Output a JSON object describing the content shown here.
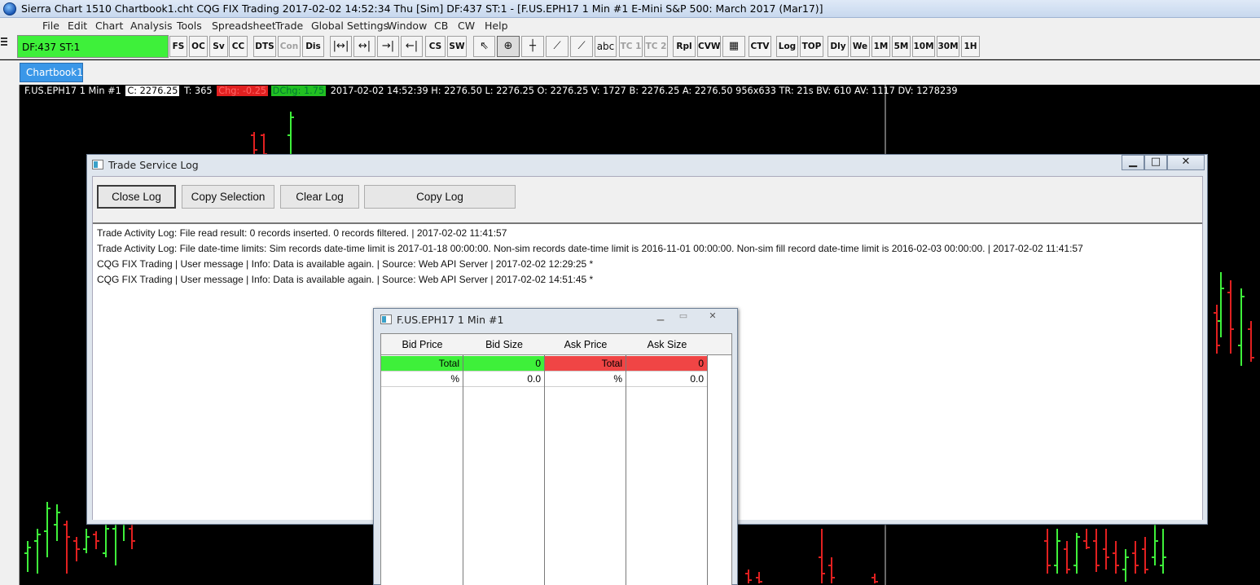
{
  "titlebar": {
    "title": "Sierra Chart 1510 Chartbook1.cht  CQG FIX Trading 2017-02-02  14:52:34 Thu [Sim]  DF:437  ST:1 - [F.US.EPH17  1 Min  #1  E-Mini S&P 500: March 2017 (Mar17)]"
  },
  "menu": [
    "File",
    "Edit",
    "Chart",
    "Analysis",
    "Tools",
    "Spreadsheet",
    "Trade",
    "Global Settings",
    "Window",
    "CB",
    "CW",
    "Help"
  ],
  "toolbar": {
    "status": "DF:437  ST:1",
    "buttons": [
      "FS",
      "OC",
      "Sv",
      "CC",
      "DTS",
      "Con",
      "Dis",
      "CS",
      "SW",
      "abc",
      "TC 1",
      "TC 2",
      "Rpl",
      "CVW",
      "CTV",
      "Log",
      "TOP",
      "Dly",
      "We",
      "1M",
      "5M",
      "10M",
      "30M",
      "1H"
    ]
  },
  "tab": {
    "label": "Chartbook1"
  },
  "chart": {
    "symbol": "F.US.EPH17  1 Min   #1",
    "close": "C: 2276.25",
    "trades": "T: 365",
    "change": "Chg: -0.25",
    "daily_change": "DChg: 1.75",
    "details": "2017-02-02 14:52:39 H: 2276.50 L: 2276.25 O: 2276.25 V: 1727 B: 2276.25 A: 2276.50 956x633 TR: 21s BV: 610 AV: 1117 DV: 1278239",
    "colors": {
      "up": "#3ef03a",
      "down": "#e12020",
      "background": "#000000"
    }
  },
  "log_window": {
    "title": "Trade Service Log",
    "buttons": {
      "close": "Close Log",
      "copy_selection": "Copy Selection",
      "clear": "Clear Log",
      "copy": "Copy Log"
    },
    "lines": [
      "Trade Activity Log: File read result: 0 records inserted.  0 records filtered. | 2017-02-02  11:41:57",
      "Trade Activity Log: File date-time limits: Sim records date-time limit is 2017-01-18  00:00:00.  Non-sim records date-time limit is 2016-11-01  00:00:00.  Non-sim fill record date-time limit is 2016-02-03  00:00:00. | 2017-02-02  11:41:57",
      "CQG FIX Trading | User message | Info: Data is available again. | Source: Web API Server | 2017-02-02  12:29:25 *",
      "CQG FIX Trading | User message | Info: Data is available again. | Source: Web API Server | 2017-02-02  14:51:45 *"
    ]
  },
  "dom_window": {
    "title": "F.US.EPH17  1 Min   #1",
    "headers": [
      "Bid Price",
      "Bid Size",
      "Ask Price",
      "Ask Size"
    ],
    "total_row": [
      "Total",
      "0",
      "Total",
      "0"
    ],
    "percent_row": [
      "%",
      "0.0",
      "%",
      "0.0"
    ],
    "colors": {
      "bid": "#3ef03a",
      "ask": "#f04545"
    }
  }
}
